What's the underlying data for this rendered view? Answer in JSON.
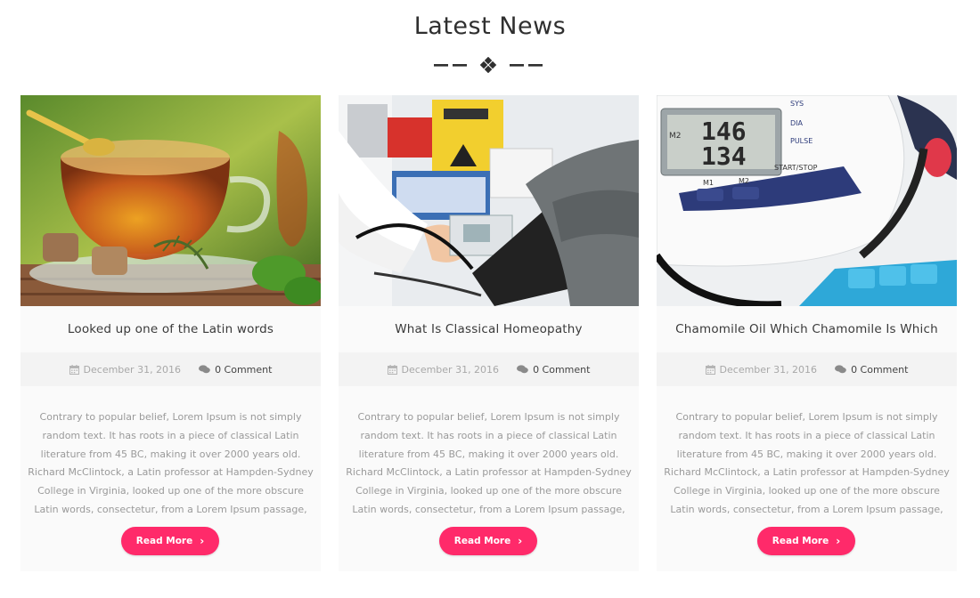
{
  "section": {
    "title": "Latest News"
  },
  "colors": {
    "accent": "#ff2a6a",
    "card_bg": "#fafafa",
    "meta_bg": "#f3f3f3",
    "divider": "#2f2f2f"
  },
  "posts": [
    {
      "image_icon": "tea-cup-image",
      "title": "Looked up one of the Latin words",
      "date": "December 31, 2016",
      "comments": "0 Comment",
      "excerpt": "Contrary to popular belief, Lorem Ipsum is not simply random text. It has roots in a piece of classical Latin literature from 45 BC, making it over 2000 years old. Richard McClintock, a Latin professor at Hampden-Sydney College in Virginia, looked up one of the more obscure Latin words, consectetur, from a Lorem Ipsum passage,",
      "button_label": "Read More"
    },
    {
      "image_icon": "blood-pressure-check-image",
      "title": "What Is Classical Homeopathy",
      "date": "December 31, 2016",
      "comments": "0 Comment",
      "excerpt": "Contrary to popular belief, Lorem Ipsum is not simply random text. It has roots in a piece of classical Latin literature from 45 BC, making it over 2000 years old. Richard McClintock, a Latin professor at Hampden-Sydney College in Virginia, looked up one of the more obscure Latin words, consectetur, from a Lorem Ipsum passage,",
      "button_label": "Read More"
    },
    {
      "image_icon": "bp-monitor-image",
      "title": "Chamomile Oil Which Chamomile Is Which",
      "date": "December 31, 2016",
      "comments": "0 Comment",
      "excerpt": "Contrary to popular belief, Lorem Ipsum is not simply random text. It has roots in a piece of classical Latin literature from 45 BC, making it over 2000 years old. Richard McClintock, a Latin professor at Hampden-Sydney College in Virginia, looked up one of the more obscure Latin words, consectetur, from a Lorem Ipsum passage,",
      "button_label": "Read More",
      "monitor_readings": {
        "top_label": "SYS",
        "sys": "146",
        "dia": "134",
        "m1": "M1",
        "m2": "M2",
        "start_stop": "START/STOP",
        "dia_label": "DIA",
        "pulse_label": "PULSE"
      }
    }
  ]
}
